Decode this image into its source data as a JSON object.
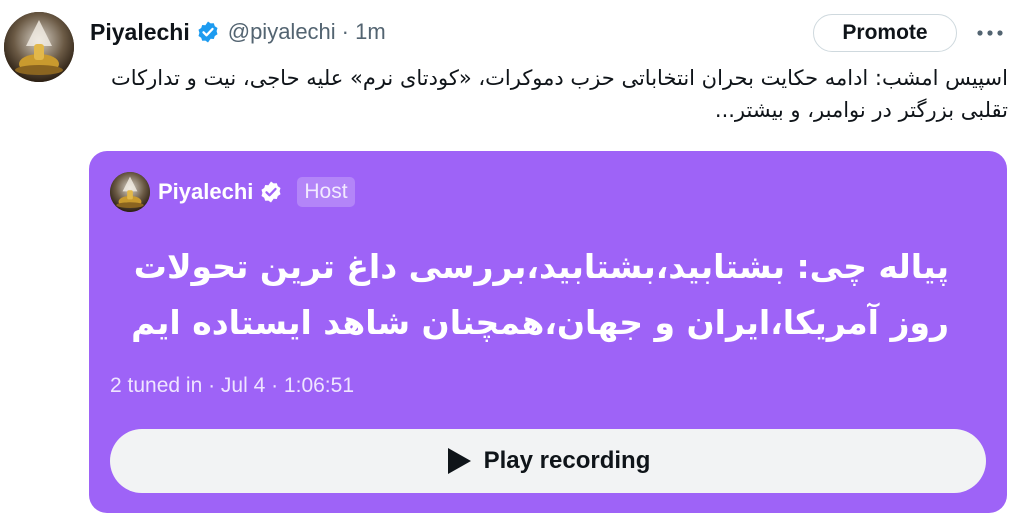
{
  "author": {
    "name": "Piyalechi",
    "handle": "@piyalechi",
    "time": "· 1m",
    "avatar_icon": "golden-bell-avatar-icon",
    "verified_icon": "verified-badge-icon"
  },
  "actions": {
    "promote_label": "Promote",
    "more_icon": "more-dots-icon"
  },
  "tweet": {
    "text": "اسپیس امشب: ادامه حکایت بحران انتخاباتی حزب دموکرات، «کودتای نرم» علیه حاجی، نیت و تدارکات تقلبی بزرگتر در نوامبر، و بیشتر..."
  },
  "space_card": {
    "host_name": "Piyalechi",
    "host_badge": "Host",
    "title": "پیاله چی: بشتابید،بشتابید،بررسی داغ ترین تحولات روز آمریکا،ایران و جهان،همچنان شاهد ایستاده ایم",
    "meta": "2 tuned in · Jul 4 · 1:06:51",
    "play_label": "Play recording",
    "play_icon": "play-triangle-icon",
    "background_color": "#9e63f7"
  },
  "colors": {
    "verified": "#1d9bf0",
    "secondary_text": "#536471",
    "button_bg": "#f2f3f4"
  }
}
